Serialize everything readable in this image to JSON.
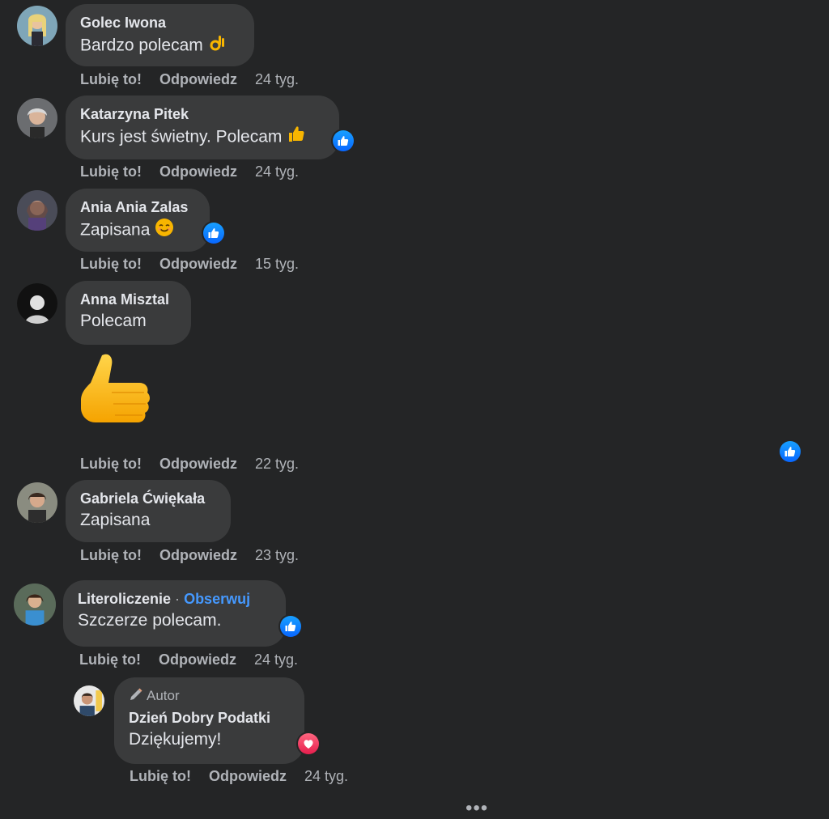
{
  "comments": [
    {
      "name": "Golec Iwona",
      "text": "Bardzo polecam",
      "emoji": "ok-hand",
      "like": "Lubię to!",
      "reply": "Odpowiedz",
      "time": "24 tyg."
    },
    {
      "name": "Katarzyna Pitek",
      "text": "Kurs jest świetny. Polecam",
      "emoji": "thumbs-up",
      "reaction": "like",
      "like": "Lubię to!",
      "reply": "Odpowiedz",
      "time": "24 tyg."
    },
    {
      "name": "Ania Ania Zalas",
      "text": "Zapisana",
      "emoji": "smiling-face",
      "reaction": "like",
      "like": "Lubię to!",
      "reply": "Odpowiedz",
      "time": "15 tyg."
    },
    {
      "name": "Anna Misztal",
      "text": "Polecam",
      "sticker": "thumbs-up-sticker",
      "reaction": "like",
      "like": "Lubię to!",
      "reply": "Odpowiedz",
      "time": "22 tyg."
    },
    {
      "name": "Gabriela Ćwiękała",
      "text": "Zapisana",
      "like": "Lubię to!",
      "reply": "Odpowiedz",
      "time": "23 tyg."
    },
    {
      "name": "Literoliczenie",
      "separator": "·",
      "follow": "Obserwuj",
      "text": "Szczerze polecam.",
      "reaction": "like",
      "like": "Lubię to!",
      "reply": "Odpowiedz",
      "time": "24 tyg."
    }
  ],
  "reply": {
    "badge": "Autor",
    "badge_icon": "pencil-icon",
    "name": "Dzień Dobry Podatki",
    "text": "Dziękujemy!",
    "reaction": "love",
    "like": "Lubię to!",
    "reply": "Odpowiedz",
    "time": "24 tyg."
  },
  "more": "•••",
  "colors": {
    "background": "#242526",
    "bubble": "#3a3b3c",
    "text": "#e4e6eb",
    "secondary": "#b0b3b8",
    "link": "#4599ff",
    "like": "#0866ff",
    "love": "#e61e4d"
  }
}
